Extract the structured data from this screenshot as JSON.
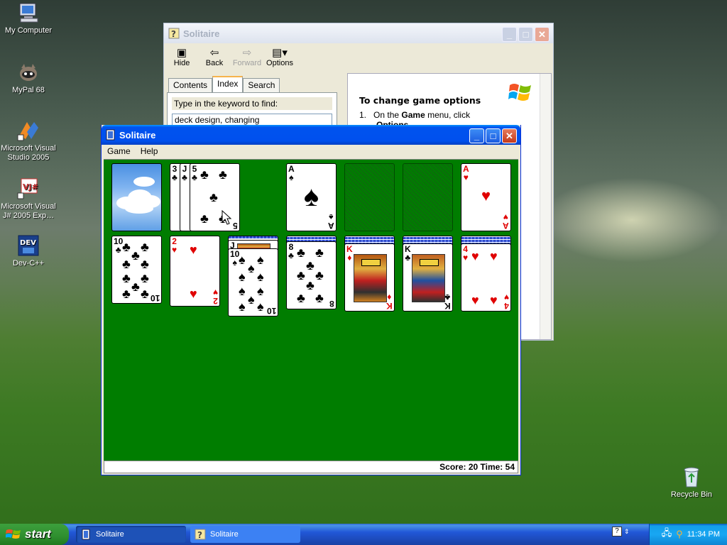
{
  "desktop": {
    "icons": [
      {
        "label": "My Computer"
      },
      {
        "label": "MyPal 68"
      },
      {
        "label": "Microsoft Visual Studio 2005"
      },
      {
        "label": "Microsoft Visual J# 2005 Exp…"
      },
      {
        "label": "Dev-C++"
      },
      {
        "label": "Recycle Bin"
      }
    ]
  },
  "help_window": {
    "title": "Solitaire",
    "toolbar": {
      "hide": "Hide",
      "back": "Back",
      "forward": "Forward",
      "options": "Options"
    },
    "tabs": [
      "Contents",
      "Index",
      "Search"
    ],
    "active_tab": "Index",
    "keyword_label": "Type in the keyword to find:",
    "keyword_value": "deck design, changing",
    "topic_title": "To change game options",
    "step_number": "1.",
    "step_text_pre": "On the ",
    "step_text_bold1": "Game",
    "step_text_mid": " menu, click",
    "step_text_bold2": "Options."
  },
  "solitaire_window": {
    "title": "Solitaire",
    "menu": [
      "Game",
      "Help"
    ],
    "status": "Score: 20 Time: 54",
    "waste": [
      {
        "rank": "3",
        "suit": "♣"
      },
      {
        "rank": "J",
        "suit": "♣"
      },
      {
        "rank": "5",
        "suit": "♣"
      }
    ],
    "foundations": [
      {
        "rank": "A",
        "suit": "♠",
        "color": "black"
      },
      {
        "empty": true
      },
      {
        "empty": true
      },
      {
        "rank": "A",
        "suit": "♥",
        "color": "red"
      }
    ],
    "tableau": [
      {
        "rank": "10",
        "suit": "♣",
        "color": "black",
        "hidden": 0
      },
      {
        "rank": "2",
        "suit": "♥",
        "color": "red",
        "hidden": 0
      },
      {
        "rank": "10",
        "suit": "♠",
        "color": "black",
        "hidden": 1,
        "under": "J"
      },
      {
        "rank": "8",
        "suit": "♣",
        "color": "black",
        "hidden": 1
      },
      {
        "rank": "K",
        "suit": "♦",
        "color": "red",
        "hidden": 2
      },
      {
        "rank": "K",
        "suit": "♣",
        "color": "black",
        "hidden": 2
      },
      {
        "rank": "4",
        "suit": "♥",
        "color": "red",
        "hidden": 2
      }
    ]
  },
  "taskbar": {
    "start": "start",
    "tasks": [
      {
        "label": "Solitaire",
        "active": true
      },
      {
        "label": "Solitaire",
        "active": false
      }
    ],
    "clock": "11:34 PM"
  }
}
